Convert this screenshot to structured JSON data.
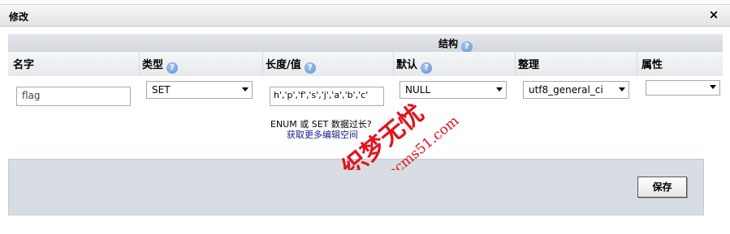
{
  "dialog": {
    "title": "修改",
    "close_icon": "×"
  },
  "section": {
    "title": "结构"
  },
  "columns": {
    "name": "名字",
    "type": "类型",
    "length": "长度/值",
    "default": "默认",
    "collation": "整理",
    "attributes": "属性"
  },
  "row": {
    "name_value": "flag",
    "type_value": "SET",
    "length_value": "h','p','f','s','j','a','b','c'",
    "default_value": "NULL",
    "collation_value": "utf8_general_ci",
    "attributes_value": ""
  },
  "length_note": {
    "line1": "ENUM 或  SET 数据过长?",
    "line2": "获取更多编辑空间"
  },
  "footer": {
    "save_label": "保存"
  },
  "watermark": {
    "brand": "织梦无忧",
    "url": "dedecms51.com"
  },
  "colors": {
    "header_bg": "#d3d8de",
    "footer_bg": "#d8dde4",
    "help_icon": "#5c8fd6",
    "watermark": "#e0141c"
  }
}
